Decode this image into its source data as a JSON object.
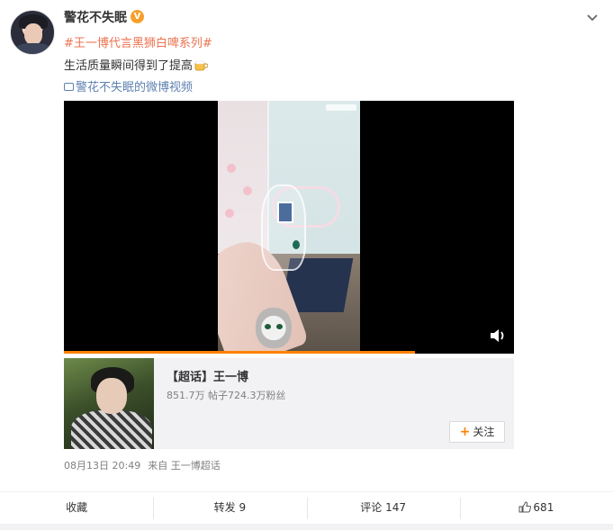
{
  "post": {
    "author": "警花不失眠",
    "verified_badge": "V",
    "topic": "#王一博代言黑狮白啤系列#",
    "text": "生活质量瞬间得到了提高",
    "video_link": "警花不失眠的微博视频",
    "video_progress_percent": 78,
    "timestamp": "08月13日 20:49",
    "source": "来自 王一博超话"
  },
  "super_topic": {
    "title": "【超话】王一博",
    "stats": "851.7万 帖子724.3万粉丝",
    "follow_label": "关注"
  },
  "actions": {
    "favorite": "收藏",
    "repost": "转发 9",
    "comment": "评论 147",
    "like": "681"
  },
  "icons": {
    "menu": "chevron-down-icon",
    "volume": "volume-icon",
    "like": "thumbs-up-icon",
    "video": "video-icon",
    "emoji": "beer-emoji-icon"
  },
  "colors": {
    "topic": "#eb7350",
    "link": "#5e81b0",
    "accent": "#ff8200",
    "badge": "#f6a02b"
  }
}
